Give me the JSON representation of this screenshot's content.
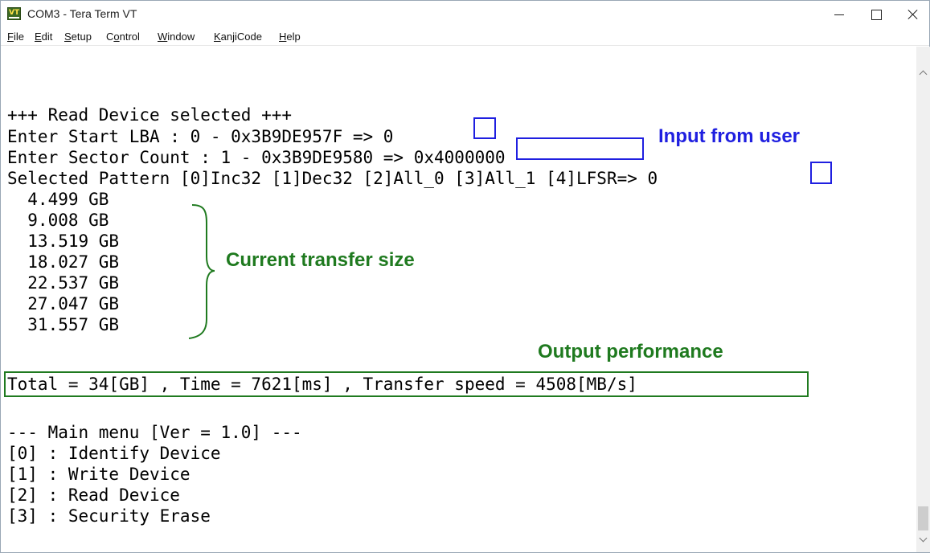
{
  "window": {
    "title": "COM3 - Tera Term VT",
    "icon_label": "VT"
  },
  "menu": [
    {
      "label": "File",
      "key": "F",
      "rest": "ile"
    },
    {
      "label": "Edit",
      "key": "E",
      "rest": "dit"
    },
    {
      "label": "Setup",
      "key": "S",
      "rest": "etup"
    },
    {
      "label": "Control",
      "key": "o",
      "pre": "C",
      "rest": "ntrol"
    },
    {
      "label": "Window",
      "key": "W",
      "rest": "indow"
    },
    {
      "label": "KanjiCode",
      "key": "K",
      "rest": "anjiCode"
    },
    {
      "label": "Help",
      "key": "H",
      "rest": "elp"
    }
  ],
  "terminal": {
    "header": "+++ Read Device selected +++",
    "lba_prompt": "Enter Start LBA : 0 - 0x3B9DE957F => ",
    "lba_input": "0",
    "count_prompt": "Enter Sector Count : 1 - 0x3B9DE9580 => ",
    "count_input": "0x4000000",
    "pattern_prompt": "Selected Pattern [0]Inc32 [1]Dec32 [2]All_0 [3]All_1 [4]LFSR=> ",
    "pattern_input": "0",
    "progress": [
      "  4.499 GB",
      "  9.008 GB",
      "  13.519 GB",
      "  18.027 GB",
      "  22.537 GB",
      "  27.047 GB",
      "  31.557 GB"
    ],
    "result": "Total = 34[GB] , Time = 7621[ms] , Transfer speed = 4508[MB/s]",
    "menu_title": "--- Main menu [Ver = 1.0] ---",
    "menu_items": [
      "[0] : Identify Device",
      "[1] : Write Device",
      "[2] : Read Device",
      "[3] : Security Erase"
    ]
  },
  "annotations": {
    "input": "Input from user",
    "transfer": "Current transfer size",
    "output": "Output performance"
  },
  "colors": {
    "annotation_blue": "#1f1fe0",
    "annotation_green": "#1f7a1f"
  }
}
